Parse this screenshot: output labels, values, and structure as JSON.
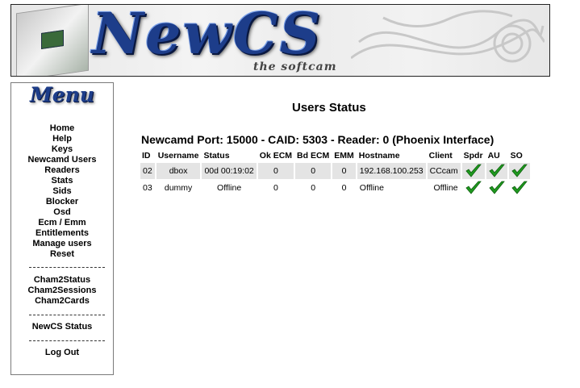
{
  "header": {
    "logo_text": "NewCS",
    "tagline": "the softcam"
  },
  "sidebar": {
    "title": "Menu",
    "groups": [
      [
        "Home",
        "Help",
        "Keys",
        "Newcamd Users",
        "Readers",
        "Stats",
        "Sids",
        "Blocker",
        "Osd",
        "Ecm / Emm",
        "Entitlements",
        "Manage users",
        "Reset"
      ],
      [
        "Cham2Status",
        "Cham2Sessions",
        "Cham2Cards"
      ],
      [
        "NewCS Status"
      ],
      [
        "Log Out"
      ]
    ]
  },
  "main": {
    "title": "Users Status",
    "port_info": "Newcamd Port: 15000 - CAID: 5303 - Reader: 0 (Phoenix Interface)",
    "columns": [
      "ID",
      "Username",
      "Status",
      "Ok ECM",
      "Bd ECM",
      "EMM",
      "Hostname",
      "Client",
      "Spdr",
      "AU",
      "SO"
    ],
    "rows": [
      {
        "id": "02",
        "username": "dbox",
        "status": "00d 00:19:02",
        "ok_ecm": "0",
        "bd_ecm": "0",
        "emm": "0",
        "hostname": "192.168.100.253",
        "client": "CCcam",
        "spdr": true,
        "au": true,
        "so": true
      },
      {
        "id": "03",
        "username": "dummy",
        "status": "Offline",
        "ok_ecm": "0",
        "bd_ecm": "0",
        "emm": "0",
        "hostname": "Offline",
        "client": "Offline",
        "spdr": true,
        "au": true,
        "so": true
      }
    ]
  },
  "colors": {
    "check_green": "#1f9a1f",
    "logo_blue": "#1d3d8a",
    "row_shade": "#e4e4e4"
  },
  "icons": {
    "check": "check-icon",
    "device": "device-icon"
  }
}
